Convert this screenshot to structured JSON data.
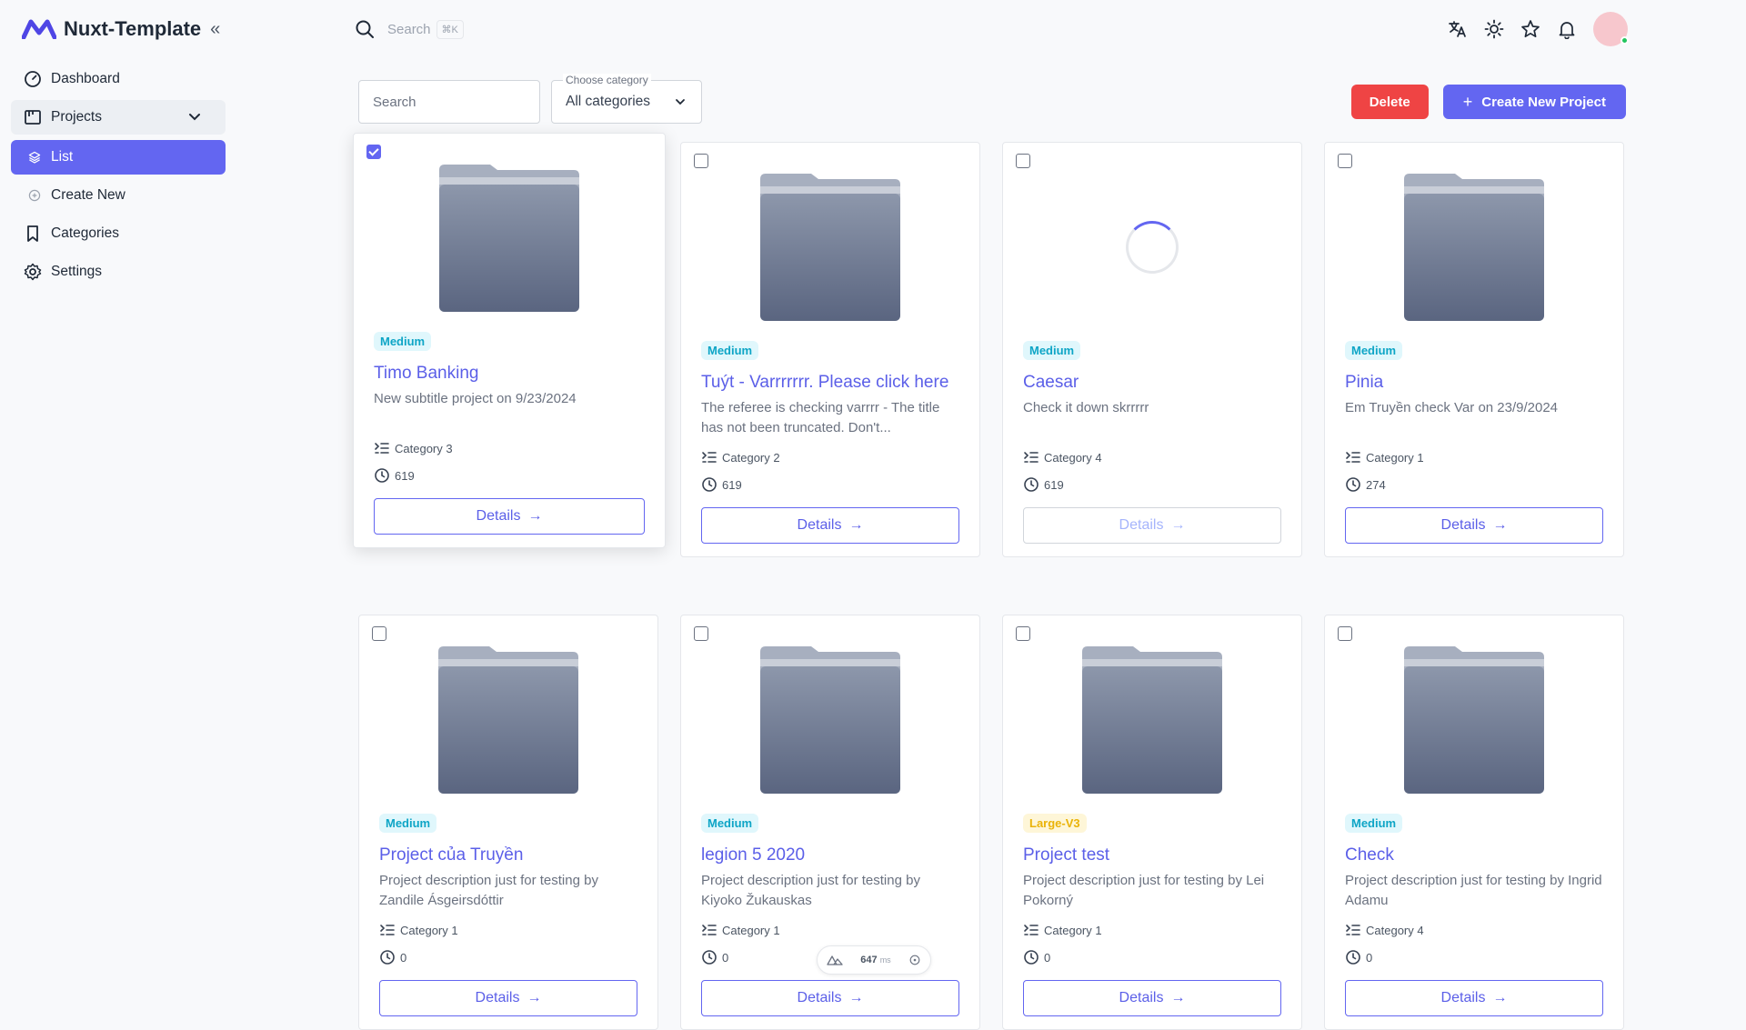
{
  "app": {
    "name": "Nuxt-Template"
  },
  "sidebar": {
    "items": [
      {
        "label": "Dashboard",
        "icon": "gauge-icon"
      },
      {
        "label": "Projects",
        "icon": "kanban-icon",
        "expanded": true
      },
      {
        "label": "List",
        "icon": "layers-icon",
        "active": true
      },
      {
        "label": "Create New",
        "icon": "plus-circle-icon"
      },
      {
        "label": "Categories",
        "icon": "bookmark-icon"
      },
      {
        "label": "Settings",
        "icon": "gear-icon"
      }
    ]
  },
  "topbar": {
    "search_placeholder": "Search",
    "shortcut": "⌘K"
  },
  "toolbar": {
    "search_placeholder": "Search",
    "category_label": "Choose category",
    "category_value": "All categories",
    "delete_label": "Delete",
    "create_label": "Create New Project"
  },
  "colors": {
    "accent": "#6366f1",
    "danger": "#ef4444",
    "medium_badge": "#0ea5c6",
    "large_badge": "#eab308"
  },
  "details_label": "Details",
  "projects": [
    {
      "badge": "Medium",
      "title": "Timo Banking",
      "subtitle": "New subtitle project on 9/23/2024",
      "category": "Category 3",
      "time": "619",
      "checked": true
    },
    {
      "badge": "Medium",
      "title": "Tuýt - Varrrrrrr. Please click here",
      "subtitle": "The referee is checking varrrr - The title has not been truncated. Don't...",
      "category": "Category 2",
      "time": "619"
    },
    {
      "badge": "Medium",
      "title": "Caesar",
      "subtitle": "Check it down skrrrrr",
      "category": "Category 4",
      "time": "619",
      "loading": true
    },
    {
      "badge": "Medium",
      "title": "Pinia",
      "subtitle": "Em Truyền check Var on 23/9/2024",
      "category": "Category 1",
      "time": "274"
    },
    {
      "badge": "Medium",
      "title": "Project của Truyền",
      "subtitle": "Project description just for testing by Zandile Ásgeirsdóttir",
      "category": "Category 1",
      "time": "0"
    },
    {
      "badge": "Medium",
      "title": "legion 5 2020",
      "subtitle": "Project description just for testing by Kiyoko Žukauskas",
      "category": "Category 1",
      "time": "0"
    },
    {
      "badge": "Large-V3",
      "title": "Project test",
      "subtitle": "Project description just for testing by Lei Pokorný",
      "category": "Category 1",
      "time": "0"
    },
    {
      "badge": "Medium",
      "title": "Check",
      "subtitle": "Project description just for testing by Ingrid Adamu",
      "category": "Category 4",
      "time": "0"
    }
  ],
  "devtools": {
    "timing": "647",
    "unit": "ms"
  }
}
